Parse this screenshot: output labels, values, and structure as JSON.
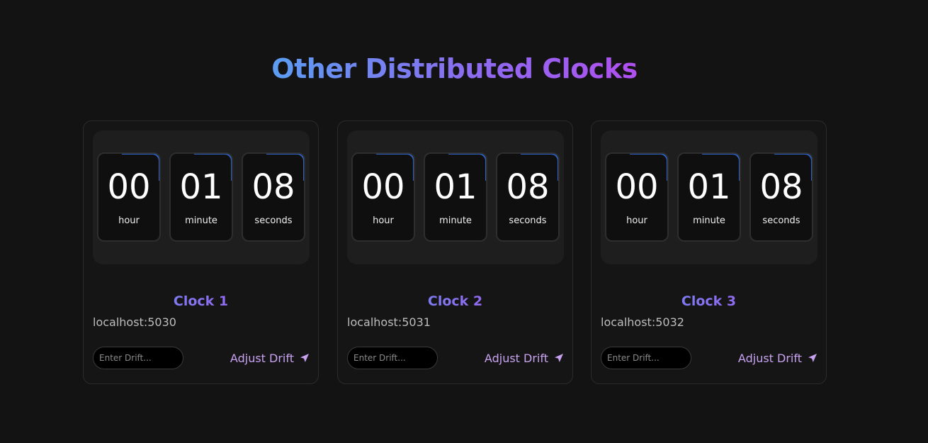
{
  "page": {
    "title": "Other Distributed Clocks"
  },
  "colors": {
    "background": "#131313",
    "title_gradient": [
      "#5b9df2",
      "#8c6cf0",
      "#b04ff0"
    ],
    "accent": "#c8a2f0",
    "tile_border_accent": "#2f63c7"
  },
  "clocks": [
    {
      "name": "Clock 1",
      "host": "localhost:5030",
      "hour": "00",
      "hour_label": "hour",
      "minute": "01",
      "minute_label": "minute",
      "seconds": "08",
      "seconds_label": "seconds",
      "drift_placeholder": "Enter Drift...",
      "button_label": "Adjust Drift",
      "button_icon": "send-icon"
    },
    {
      "name": "Clock 2",
      "host": "localhost:5031",
      "hour": "00",
      "hour_label": "hour",
      "minute": "01",
      "minute_label": "minute",
      "seconds": "08",
      "seconds_label": "seconds",
      "drift_placeholder": "Enter Drift...",
      "button_label": "Adjust Drift",
      "button_icon": "send-icon"
    },
    {
      "name": "Clock 3",
      "host": "localhost:5032",
      "hour": "00",
      "hour_label": "hour",
      "minute": "01",
      "minute_label": "minute",
      "seconds": "08",
      "seconds_label": "seconds",
      "drift_placeholder": "Enter Drift...",
      "button_label": "Adjust Drift",
      "button_icon": "send-icon"
    }
  ]
}
